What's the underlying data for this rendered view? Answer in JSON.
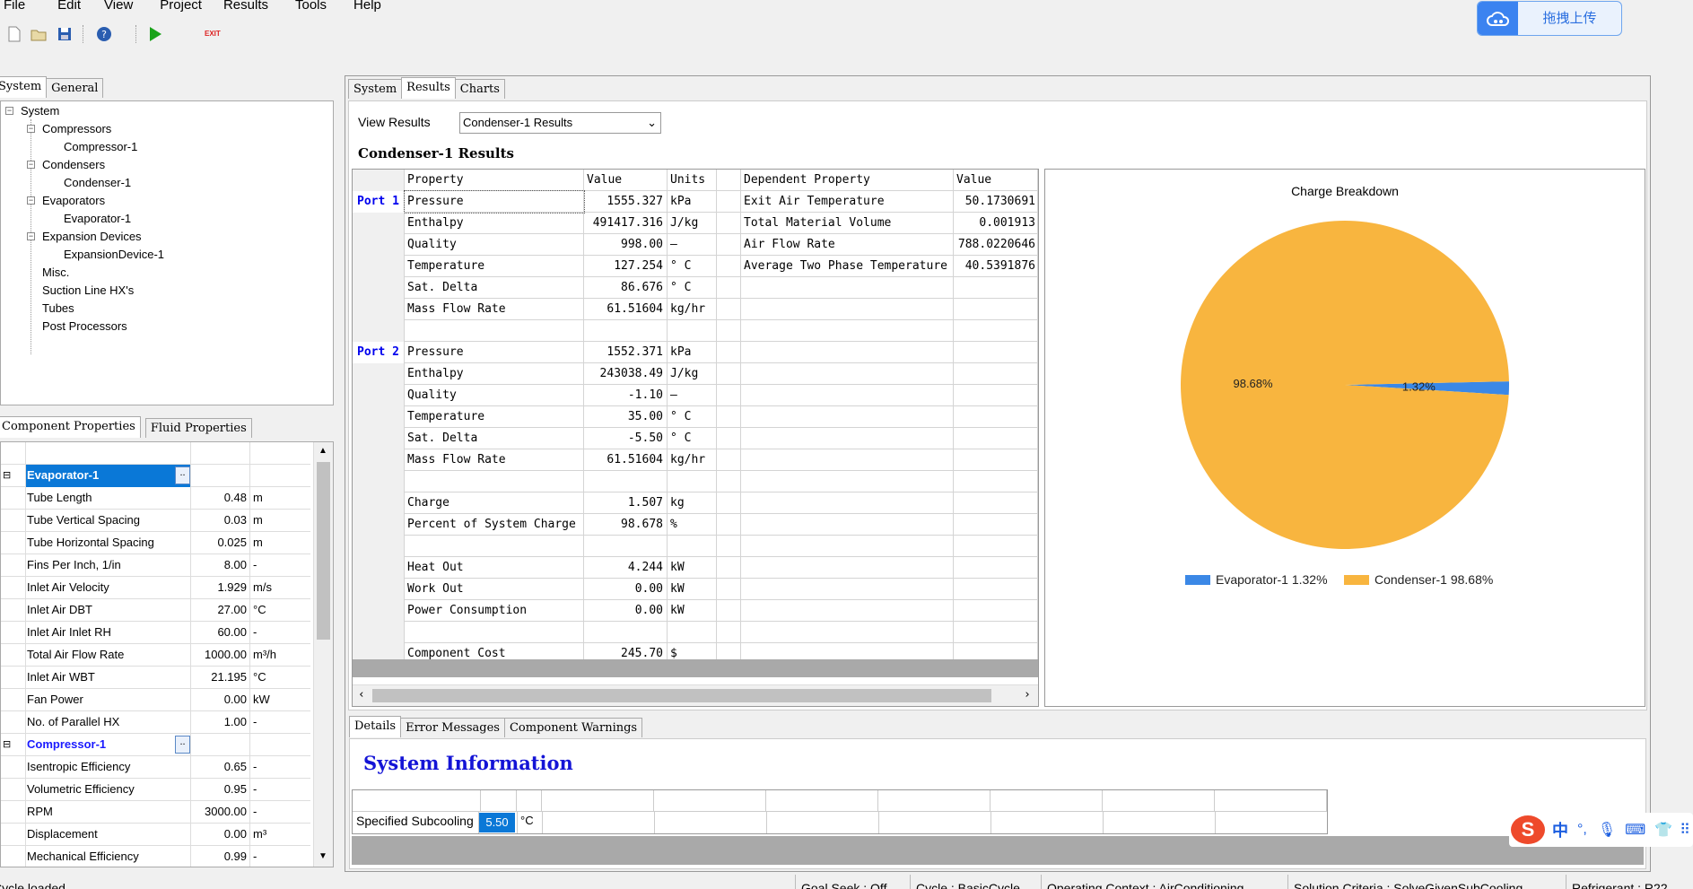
{
  "menu": [
    "File",
    "Edit",
    "View",
    "Project",
    "Results",
    "Tools",
    "Help"
  ],
  "toolbar": {
    "exit_label": "EXIT"
  },
  "cloud": {
    "label": "拖拽上传"
  },
  "left_tabs_top": [
    "System",
    "General"
  ],
  "tree": {
    "root": "System",
    "nodes": [
      {
        "label": "Compressors",
        "children": [
          "Compressor-1"
        ]
      },
      {
        "label": "Condensers",
        "children": [
          "Condenser-1"
        ]
      },
      {
        "label": "Evaporators",
        "children": [
          "Evaporator-1"
        ]
      },
      {
        "label": "Expansion Devices",
        "children": [
          "ExpansionDevice-1"
        ]
      },
      {
        "label": "Misc.",
        "children": []
      },
      {
        "label": "Suction Line HX's",
        "children": []
      },
      {
        "label": "Tubes",
        "children": []
      },
      {
        "label": "Post Processors",
        "children": []
      }
    ]
  },
  "left_tabs_bottom": [
    "Component Properties",
    "Fluid Properties"
  ],
  "property_grid": {
    "ellipsis": "..",
    "groups": [
      {
        "name": "Evaporator-1",
        "rows": [
          {
            "name": "Tube Length",
            "value": "0.48",
            "unit": "m"
          },
          {
            "name": "Tube Vertical Spacing",
            "value": "0.03",
            "unit": "m"
          },
          {
            "name": "Tube Horizontal Spacing",
            "value": "0.025",
            "unit": "m"
          },
          {
            "name": "Fins Per Inch, 1/in",
            "value": "8.00",
            "unit": "-"
          },
          {
            "name": "Inlet Air Velocity",
            "value": "1.929",
            "unit": "m/s"
          },
          {
            "name": "Inlet Air DBT",
            "value": "27.00",
            "unit": "°C"
          },
          {
            "name": "Inlet Air Inlet RH",
            "value": "60.00",
            "unit": "-"
          },
          {
            "name": "Total Air Flow Rate",
            "value": "1000.00",
            "unit": "m³/h"
          },
          {
            "name": "Inlet Air WBT",
            "value": "21.195",
            "unit": "°C"
          },
          {
            "name": "Fan Power",
            "value": "0.00",
            "unit": "kW"
          },
          {
            "name": "No. of Parallel HX",
            "value": "1.00",
            "unit": "-"
          }
        ]
      },
      {
        "name": "Compressor-1",
        "rows": [
          {
            "name": "Isentropic Efficiency",
            "value": "0.65",
            "unit": "-"
          },
          {
            "name": "Volumetric Efficiency",
            "value": "0.95",
            "unit": "-"
          },
          {
            "name": "RPM",
            "value": "3000.00",
            "unit": "-"
          },
          {
            "name": "Displacement",
            "value": "0.00",
            "unit": "m³"
          },
          {
            "name": "Mechanical Efficiency",
            "value": "0.99",
            "unit": "-"
          }
        ]
      }
    ]
  },
  "right_tabs": [
    "System",
    "Results",
    "Charts"
  ],
  "view_results": {
    "label": "View Results",
    "selected": "Condenser-1 Results"
  },
  "results_heading": "Condenser-1 Results",
  "results_table": {
    "headers": [
      "Property",
      "Value",
      "Units",
      "Dependent Property",
      "Value"
    ],
    "rows": [
      {
        "port": "Port 1",
        "property": "Pressure",
        "value": "1555.327",
        "unit": "kPa",
        "dep": "Exit Air Temperature",
        "dep_value": "50.1730691"
      },
      {
        "port": "",
        "property": "Enthalpy",
        "value": "491417.316",
        "unit": "J/kg",
        "dep": "Total Material Volume",
        "dep_value": "0.001913"
      },
      {
        "port": "",
        "property": "Quality",
        "value": "998.00",
        "unit": "–",
        "dep": "Air Flow Rate",
        "dep_value": "788.0220646"
      },
      {
        "port": "",
        "property": "Temperature",
        "value": "127.254",
        "unit": "° C",
        "dep": "Average Two Phase Temperature",
        "dep_value": "40.5391876"
      },
      {
        "port": "",
        "property": "Sat. Delta",
        "value": "86.676",
        "unit": "° C",
        "dep": "",
        "dep_value": ""
      },
      {
        "port": "",
        "property": "Mass Flow Rate",
        "value": "61.51604",
        "unit": "kg/hr",
        "dep": "",
        "dep_value": ""
      },
      {
        "port": "",
        "property": "",
        "value": "",
        "unit": "",
        "dep": "",
        "dep_value": ""
      },
      {
        "port": "Port 2",
        "property": "Pressure",
        "value": "1552.371",
        "unit": "kPa",
        "dep": "",
        "dep_value": ""
      },
      {
        "port": "",
        "property": "Enthalpy",
        "value": "243038.49",
        "unit": "J/kg",
        "dep": "",
        "dep_value": ""
      },
      {
        "port": "",
        "property": "Quality",
        "value": "-1.10",
        "unit": "–",
        "dep": "",
        "dep_value": ""
      },
      {
        "port": "",
        "property": "Temperature",
        "value": "35.00",
        "unit": "° C",
        "dep": "",
        "dep_value": ""
      },
      {
        "port": "",
        "property": "Sat. Delta",
        "value": "-5.50",
        "unit": "° C",
        "dep": "",
        "dep_value": ""
      },
      {
        "port": "",
        "property": "Mass Flow Rate",
        "value": "61.51604",
        "unit": "kg/hr",
        "dep": "",
        "dep_value": ""
      },
      {
        "port": "",
        "property": "",
        "value": "",
        "unit": "",
        "dep": "",
        "dep_value": ""
      },
      {
        "port": "",
        "property": "Charge",
        "value": "1.507",
        "unit": "kg",
        "dep": "",
        "dep_value": ""
      },
      {
        "port": "",
        "property": "Percent of System Charge",
        "value": "98.678",
        "unit": "%",
        "dep": "",
        "dep_value": ""
      },
      {
        "port": "",
        "property": "",
        "value": "",
        "unit": "",
        "dep": "",
        "dep_value": ""
      },
      {
        "port": "",
        "property": "Heat Out",
        "value": "4.244",
        "unit": "kW",
        "dep": "",
        "dep_value": ""
      },
      {
        "port": "",
        "property": "Work Out",
        "value": "0.00",
        "unit": "kW",
        "dep": "",
        "dep_value": ""
      },
      {
        "port": "",
        "property": "Power Consumption",
        "value": "0.00",
        "unit": "kW",
        "dep": "",
        "dep_value": ""
      },
      {
        "port": "",
        "property": "",
        "value": "",
        "unit": "",
        "dep": "",
        "dep_value": ""
      },
      {
        "port": "",
        "property": "Component Cost",
        "value": "245.70",
        "unit": "$",
        "dep": "",
        "dep_value": ""
      }
    ]
  },
  "chart_data": {
    "type": "pie",
    "title": "Charge Breakdown",
    "categories": [
      "Evaporator-1",
      "Condenser-1"
    ],
    "values": [
      1.32,
      98.68
    ],
    "labels": [
      "1.32%",
      "98.68%"
    ],
    "legend": [
      "Evaporator-1  1.32%",
      "Condenser-1  98.68%"
    ],
    "colors": [
      "#3b88e6",
      "#f8b53f"
    ],
    "legend_position": "bottom"
  },
  "bottom_tabs": [
    "Details",
    "Error Messages",
    "Component Warnings"
  ],
  "system_info": {
    "title": "System Information",
    "label": "Specified Subcooling",
    "value": "5.50",
    "unit": "°C"
  },
  "status": {
    "left": "Cycle loaded",
    "goal_seek": "Goal Seek : Off",
    "cycle": "Cycle : BasicCycle",
    "context": "Operating Context : AirConditioning",
    "criteria": "Solution Criteria : SolveGivenSubCooling",
    "refrigerant": "Refrigerant : R22"
  },
  "ime": {
    "lang": "中"
  },
  "colors": {
    "accent": "#0a78d7",
    "link_blue": "#1414d6",
    "pie_orange": "#f8b53f",
    "pie_blue": "#3b88e6"
  }
}
